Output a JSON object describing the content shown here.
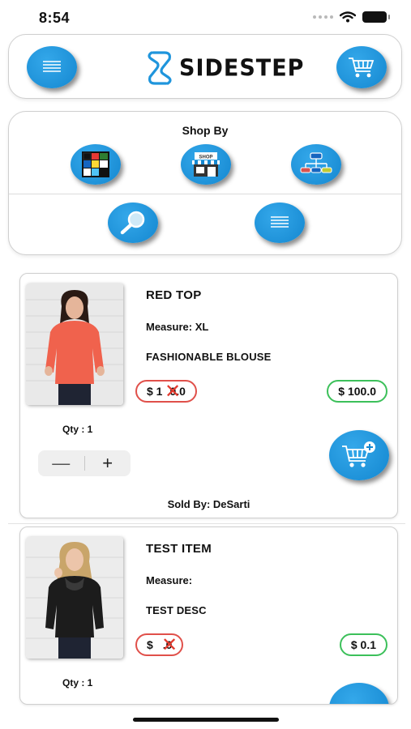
{
  "status_bar": {
    "time": "8:54"
  },
  "header": {
    "brand": "SIDESTEP",
    "menu_icon": "menu-icon",
    "cart_icon": "cart-icon"
  },
  "shop_by": {
    "title": "Shop By",
    "options": [
      "color-grid-icon",
      "store-icon",
      "hierarchy-icon",
      "search-icon",
      "list-icon"
    ]
  },
  "products": [
    {
      "title": "RED TOP",
      "measure": "Measure: XL",
      "description": "FASHIONABLE BLOUSE",
      "old_price_prefix": "$ 1",
      "old_price_suffix": "0.0",
      "new_price": "$ 100.0",
      "qty": "Qty : 1",
      "sold_by": "Sold By: DeSarti",
      "accent": "#f0624d"
    },
    {
      "title": "TEST ITEM",
      "measure": "Measure:",
      "description": "TEST DESC",
      "old_price_prefix": "$ ",
      "old_price_suffix": ".0",
      "new_price": "$ 0.1",
      "qty": "Qty : 1",
      "accent": "#1c1c1c"
    }
  ],
  "colors": {
    "accent_blue": "#1f95dc",
    "old_price_border": "#e0504a",
    "new_price_border": "#3cc05a"
  }
}
